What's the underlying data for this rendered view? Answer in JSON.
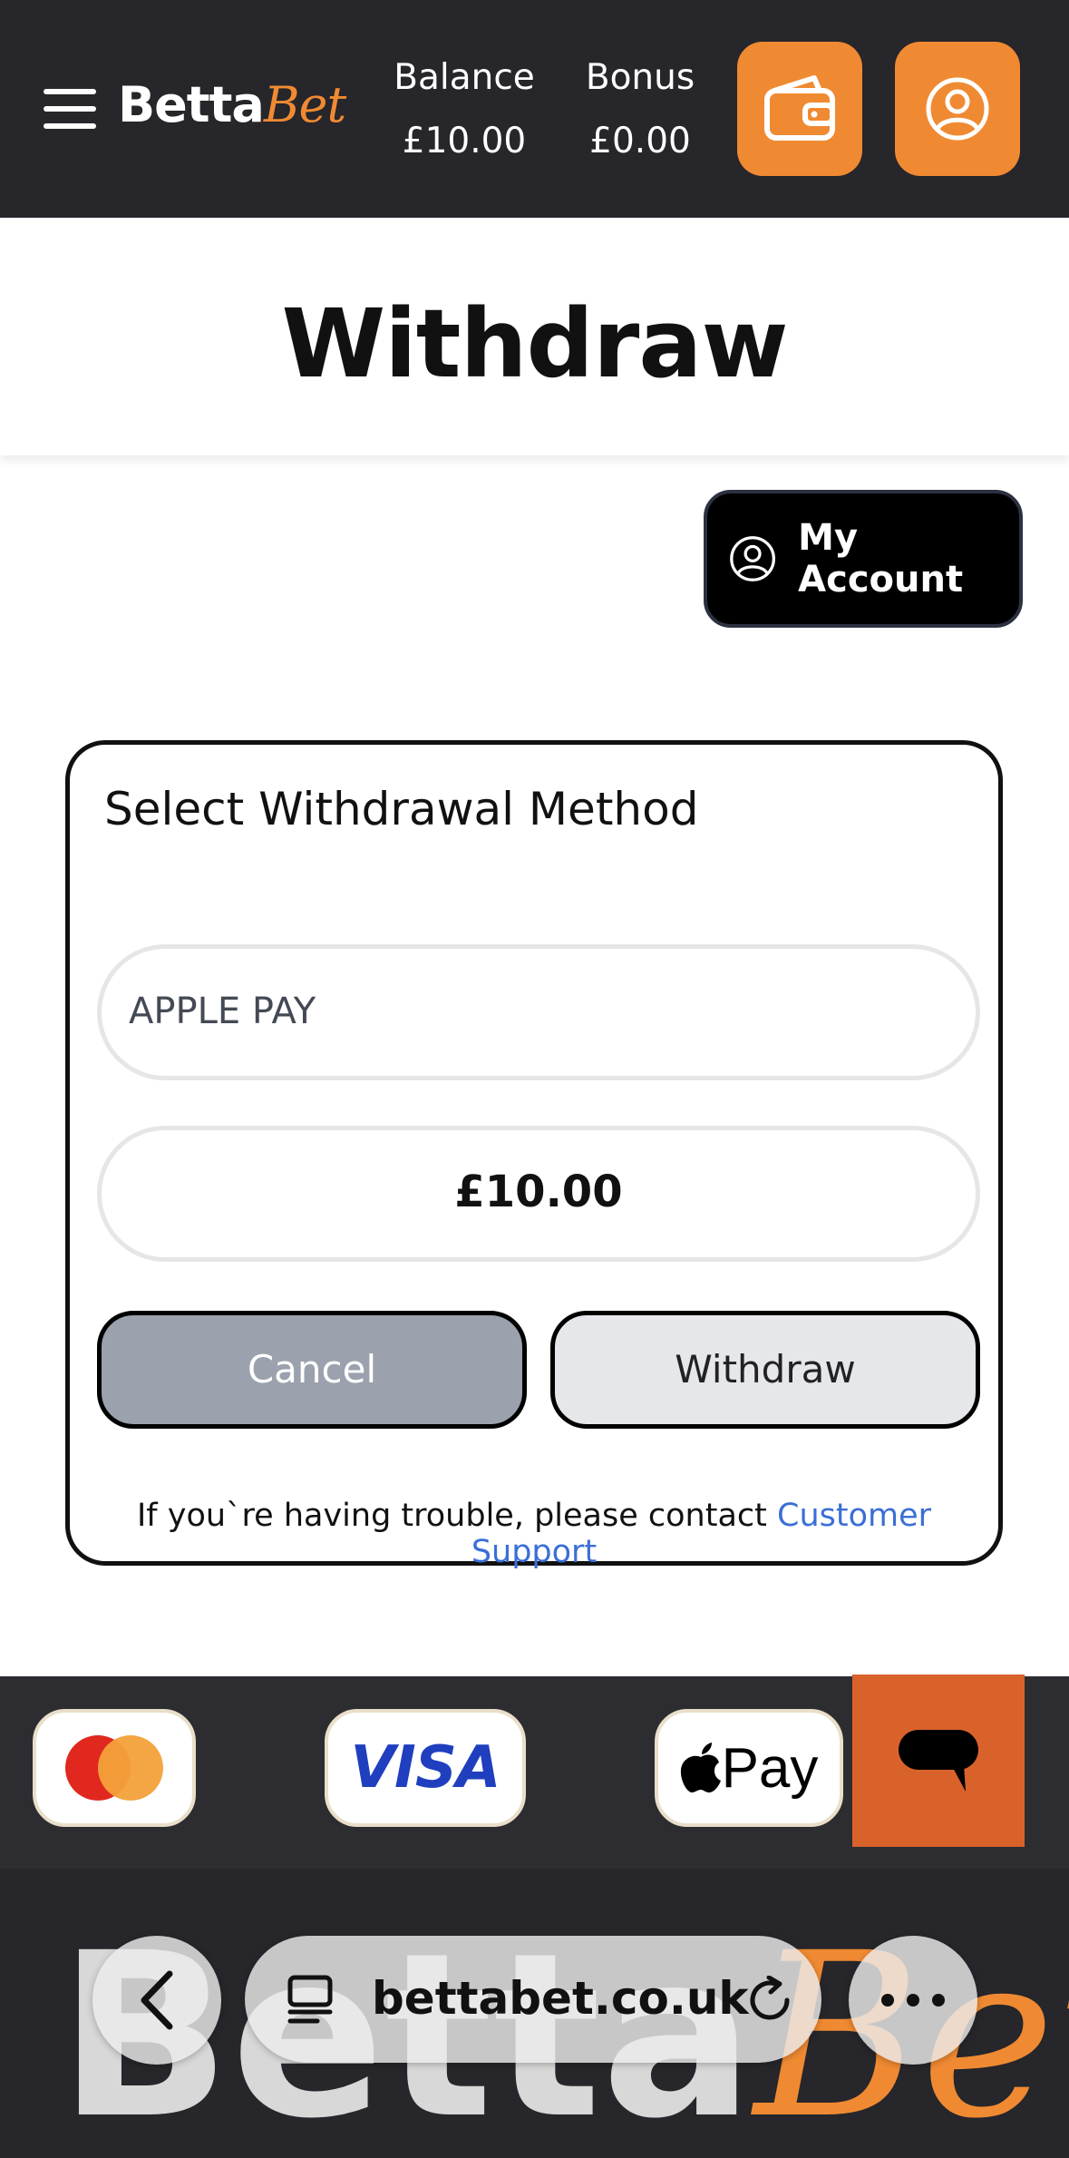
{
  "header": {
    "brand": {
      "part1": "Betta",
      "part2": "Bet"
    },
    "balance": {
      "label": "Balance",
      "value": "£10.00"
    },
    "bonus": {
      "label": "Bonus",
      "value": "£0.00"
    }
  },
  "page": {
    "title": "Withdraw"
  },
  "account_button": {
    "label": "My Account"
  },
  "withdraw_card": {
    "title": "Select Withdrawal Method",
    "method_value": "APPLE PAY",
    "amount_value": "£10.00",
    "cancel_label": "Cancel",
    "withdraw_label": "Withdraw",
    "help_text": "If you`re having trouble, please contact ",
    "help_link": "Customer Support"
  },
  "payments": {
    "visa": "VISA",
    "apple_pay": "Pay"
  },
  "browser": {
    "url": "bettabet.co.uk"
  },
  "colors": {
    "accent": "#f08a32",
    "header_bg": "#26262b",
    "chat_bg": "#d9622b",
    "link": "#3b6fd6"
  }
}
